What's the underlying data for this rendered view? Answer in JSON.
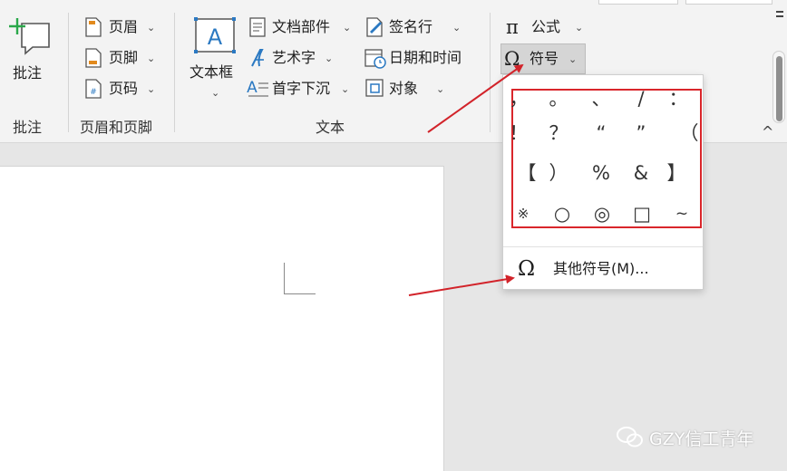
{
  "ribbon": {
    "comment_group": {
      "button_label": "批注",
      "group_label": "批注"
    },
    "header_footer_group": {
      "group_label": "页眉和页脚",
      "items": [
        {
          "label": "页眉",
          "icon": "header-icon"
        },
        {
          "label": "页脚",
          "icon": "footer-icon"
        },
        {
          "label": "页码",
          "icon": "page-number-icon"
        }
      ]
    },
    "text_group": {
      "group_label": "文本",
      "textbox_label": "文本框",
      "col1": [
        {
          "label": "文档部件",
          "icon": "quick-parts-icon"
        },
        {
          "label": "艺术字",
          "icon": "wordart-icon"
        },
        {
          "label": "首字下沉",
          "icon": "drop-cap-icon"
        }
      ],
      "col2": [
        {
          "label": "签名行",
          "icon": "signature-line-icon"
        },
        {
          "label": "日期和时间",
          "icon": "date-time-icon"
        },
        {
          "label": "对象",
          "icon": "object-icon"
        }
      ]
    },
    "symbols_group": {
      "equation_label": "公式",
      "equation_glyph": "π",
      "symbol_label": "符号",
      "symbol_glyph": "Ω"
    },
    "collapse_glyph": "^"
  },
  "symbol_dropdown": {
    "symbols": [
      [
        "，",
        "。",
        "、",
        "/",
        "："
      ],
      [
        "！",
        "？",
        "“",
        "”",
        "（"
      ],
      [
        "【",
        "）",
        "%",
        "&",
        "】"
      ],
      [
        "※",
        "○",
        "◎",
        "□",
        "~"
      ]
    ],
    "other_glyph": "Ω",
    "other_label": "其他符号(M)..."
  },
  "watermark": {
    "text": "GZY信工青年"
  },
  "colors": {
    "highlight_box": "#d9262b",
    "annotation_arrow": "#d2232a",
    "accent_blue": "#2b79c2"
  }
}
